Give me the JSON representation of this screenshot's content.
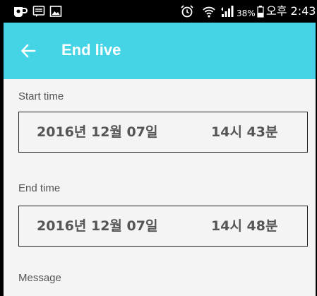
{
  "status_bar": {
    "battery_percent": "38%",
    "time": "오후 2:43",
    "icons": [
      "app-notification-icon",
      "message-icon",
      "image-icon",
      "alarm-icon",
      "wifi-icon",
      "signal-icon",
      "battery-icon"
    ]
  },
  "app_bar": {
    "title": "End live",
    "back_icon": "back-arrow-icon",
    "color": "#45d4e6"
  },
  "start": {
    "label": "Start time",
    "date": "2016년 12월 07일",
    "time": "14시 43분"
  },
  "end": {
    "label": "End time",
    "date": "2016년 12월 07일",
    "time": "14시 48분"
  },
  "message": {
    "label": "Message"
  }
}
